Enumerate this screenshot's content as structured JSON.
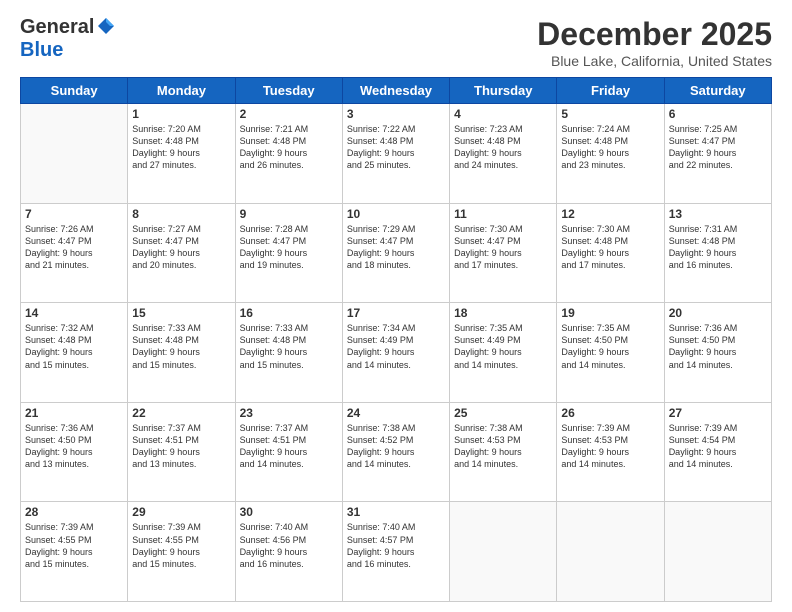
{
  "logo": {
    "general": "General",
    "blue": "Blue"
  },
  "title": "December 2025",
  "location": "Blue Lake, California, United States",
  "days_of_week": [
    "Sunday",
    "Monday",
    "Tuesday",
    "Wednesday",
    "Thursday",
    "Friday",
    "Saturday"
  ],
  "weeks": [
    [
      {
        "day": "",
        "info": ""
      },
      {
        "day": "1",
        "info": "Sunrise: 7:20 AM\nSunset: 4:48 PM\nDaylight: 9 hours\nand 27 minutes."
      },
      {
        "day": "2",
        "info": "Sunrise: 7:21 AM\nSunset: 4:48 PM\nDaylight: 9 hours\nand 26 minutes."
      },
      {
        "day": "3",
        "info": "Sunrise: 7:22 AM\nSunset: 4:48 PM\nDaylight: 9 hours\nand 25 minutes."
      },
      {
        "day": "4",
        "info": "Sunrise: 7:23 AM\nSunset: 4:48 PM\nDaylight: 9 hours\nand 24 minutes."
      },
      {
        "day": "5",
        "info": "Sunrise: 7:24 AM\nSunset: 4:48 PM\nDaylight: 9 hours\nand 23 minutes."
      },
      {
        "day": "6",
        "info": "Sunrise: 7:25 AM\nSunset: 4:47 PM\nDaylight: 9 hours\nand 22 minutes."
      }
    ],
    [
      {
        "day": "7",
        "info": "Sunrise: 7:26 AM\nSunset: 4:47 PM\nDaylight: 9 hours\nand 21 minutes."
      },
      {
        "day": "8",
        "info": "Sunrise: 7:27 AM\nSunset: 4:47 PM\nDaylight: 9 hours\nand 20 minutes."
      },
      {
        "day": "9",
        "info": "Sunrise: 7:28 AM\nSunset: 4:47 PM\nDaylight: 9 hours\nand 19 minutes."
      },
      {
        "day": "10",
        "info": "Sunrise: 7:29 AM\nSunset: 4:47 PM\nDaylight: 9 hours\nand 18 minutes."
      },
      {
        "day": "11",
        "info": "Sunrise: 7:30 AM\nSunset: 4:47 PM\nDaylight: 9 hours\nand 17 minutes."
      },
      {
        "day": "12",
        "info": "Sunrise: 7:30 AM\nSunset: 4:48 PM\nDaylight: 9 hours\nand 17 minutes."
      },
      {
        "day": "13",
        "info": "Sunrise: 7:31 AM\nSunset: 4:48 PM\nDaylight: 9 hours\nand 16 minutes."
      }
    ],
    [
      {
        "day": "14",
        "info": "Sunrise: 7:32 AM\nSunset: 4:48 PM\nDaylight: 9 hours\nand 15 minutes."
      },
      {
        "day": "15",
        "info": "Sunrise: 7:33 AM\nSunset: 4:48 PM\nDaylight: 9 hours\nand 15 minutes."
      },
      {
        "day": "16",
        "info": "Sunrise: 7:33 AM\nSunset: 4:48 PM\nDaylight: 9 hours\nand 15 minutes."
      },
      {
        "day": "17",
        "info": "Sunrise: 7:34 AM\nSunset: 4:49 PM\nDaylight: 9 hours\nand 14 minutes."
      },
      {
        "day": "18",
        "info": "Sunrise: 7:35 AM\nSunset: 4:49 PM\nDaylight: 9 hours\nand 14 minutes."
      },
      {
        "day": "19",
        "info": "Sunrise: 7:35 AM\nSunset: 4:50 PM\nDaylight: 9 hours\nand 14 minutes."
      },
      {
        "day": "20",
        "info": "Sunrise: 7:36 AM\nSunset: 4:50 PM\nDaylight: 9 hours\nand 14 minutes."
      }
    ],
    [
      {
        "day": "21",
        "info": "Sunrise: 7:36 AM\nSunset: 4:50 PM\nDaylight: 9 hours\nand 13 minutes."
      },
      {
        "day": "22",
        "info": "Sunrise: 7:37 AM\nSunset: 4:51 PM\nDaylight: 9 hours\nand 13 minutes."
      },
      {
        "day": "23",
        "info": "Sunrise: 7:37 AM\nSunset: 4:51 PM\nDaylight: 9 hours\nand 14 minutes."
      },
      {
        "day": "24",
        "info": "Sunrise: 7:38 AM\nSunset: 4:52 PM\nDaylight: 9 hours\nand 14 minutes."
      },
      {
        "day": "25",
        "info": "Sunrise: 7:38 AM\nSunset: 4:53 PM\nDaylight: 9 hours\nand 14 minutes."
      },
      {
        "day": "26",
        "info": "Sunrise: 7:39 AM\nSunset: 4:53 PM\nDaylight: 9 hours\nand 14 minutes."
      },
      {
        "day": "27",
        "info": "Sunrise: 7:39 AM\nSunset: 4:54 PM\nDaylight: 9 hours\nand 14 minutes."
      }
    ],
    [
      {
        "day": "28",
        "info": "Sunrise: 7:39 AM\nSunset: 4:55 PM\nDaylight: 9 hours\nand 15 minutes."
      },
      {
        "day": "29",
        "info": "Sunrise: 7:39 AM\nSunset: 4:55 PM\nDaylight: 9 hours\nand 15 minutes."
      },
      {
        "day": "30",
        "info": "Sunrise: 7:40 AM\nSunset: 4:56 PM\nDaylight: 9 hours\nand 16 minutes."
      },
      {
        "day": "31",
        "info": "Sunrise: 7:40 AM\nSunset: 4:57 PM\nDaylight: 9 hours\nand 16 minutes."
      },
      {
        "day": "",
        "info": ""
      },
      {
        "day": "",
        "info": ""
      },
      {
        "day": "",
        "info": ""
      }
    ]
  ]
}
